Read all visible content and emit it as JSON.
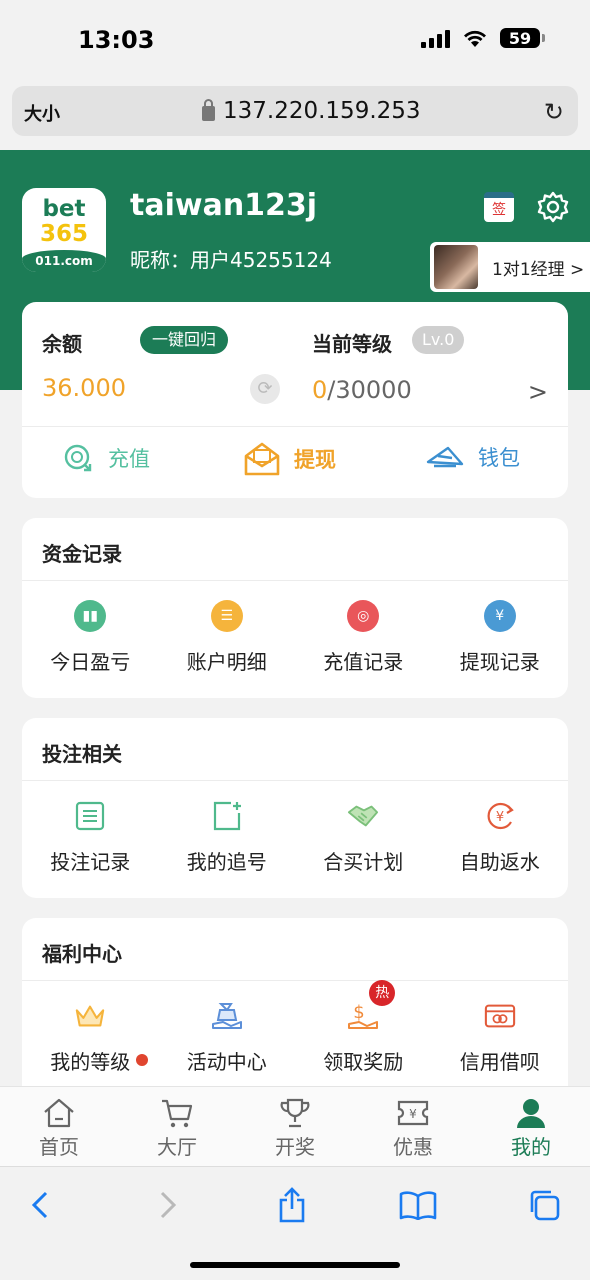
{
  "status": {
    "time": "13:03",
    "battery": "59"
  },
  "browser": {
    "text_size_label": "大小",
    "url": "137.220.159.253"
  },
  "profile": {
    "logo_line1": "bet",
    "logo_line2": "365",
    "logo_line3": "011.com",
    "username": "taiwan123j",
    "nickname": "昵称：用户45255124",
    "sign_label": "签",
    "manager_label": "1对1经理 >"
  },
  "balance": {
    "label": "余额",
    "return_button": "一键回归",
    "value": "36.000",
    "level_label": "当前等级",
    "level_badge": "Lv.0",
    "level_current": "0",
    "level_total": "/30000",
    "arrow": ">"
  },
  "actions": [
    {
      "label": "充值",
      "icon": "recharge-icon"
    },
    {
      "label": "提现",
      "icon": "withdraw-icon"
    },
    {
      "label": "钱包",
      "icon": "wallet-icon"
    }
  ],
  "sections": [
    {
      "title": "资金记录",
      "items": [
        {
          "label": "今日盈亏",
          "icon": "chart-icon",
          "color": "#4fb98c"
        },
        {
          "label": "账户明细",
          "icon": "document-icon",
          "color": "#f5b43c"
        },
        {
          "label": "充值记录",
          "icon": "coins-icon",
          "color": "#e9565a"
        },
        {
          "label": "提现记录",
          "icon": "yen-refund-icon",
          "color": "#4a9ad4"
        }
      ]
    },
    {
      "title": "投注相关",
      "items": [
        {
          "label": "投注记录",
          "icon": "list-icon",
          "color": "#4fb98c"
        },
        {
          "label": "我的追号",
          "icon": "add-square-icon",
          "color": "#4fb98c"
        },
        {
          "label": "合买计划",
          "icon": "handshake-icon",
          "color": "#7bc07a"
        },
        {
          "label": "自助返水",
          "icon": "yen-cycle-icon",
          "color": "#e25a3a"
        }
      ]
    },
    {
      "title": "福利中心",
      "items": [
        {
          "label": "我的等级",
          "icon": "crown-icon",
          "color": "#f5b43c",
          "dot": true
        },
        {
          "label": "活动中心",
          "icon": "gift-hand-icon",
          "color": "#5c8fd8"
        },
        {
          "label": "领取奖励",
          "icon": "money-hand-icon",
          "color": "#f08a3a",
          "badge": "热"
        },
        {
          "label": "信用借呗",
          "icon": "card-icon",
          "color": "#e25a3a"
        }
      ]
    }
  ],
  "tabs": [
    {
      "label": "首页",
      "icon": "home-icon"
    },
    {
      "label": "大厅",
      "icon": "cart-icon"
    },
    {
      "label": "开奖",
      "icon": "trophy-icon"
    },
    {
      "label": "优惠",
      "icon": "coupon-icon"
    },
    {
      "label": "我的",
      "icon": "person-icon",
      "active": true
    }
  ],
  "colors": {
    "brand_green": "#1c7c56",
    "accent_orange": "#f0a32a",
    "wallet_blue": "#3b8fd0"
  }
}
